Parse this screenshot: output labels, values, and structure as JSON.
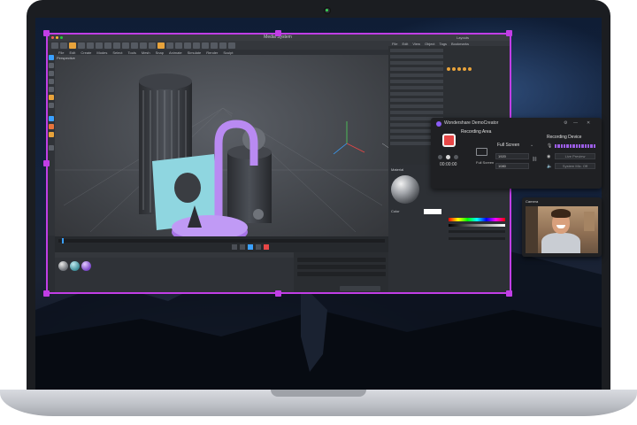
{
  "app": {
    "window_title": "Media System",
    "layout_label": "Layouts",
    "viewport_label": "Perspective",
    "menus": [
      "File",
      "Edit",
      "Create",
      "Modes",
      "Select",
      "Tools",
      "Mesh",
      "Snap",
      "Animate",
      "Simulate",
      "Render",
      "Sculpt",
      "Motion Tracker",
      "MoGraph",
      "Character",
      "Pipeline",
      "Plugins",
      "Script",
      "Window",
      "Help"
    ],
    "right_menus": [
      "File",
      "Edit",
      "View",
      "Object",
      "Tags",
      "Bookmarks"
    ],
    "attr_tab": "Material",
    "color_label": "Color"
  },
  "recorder": {
    "title": "Wondershare DemoCreator",
    "mode": "Recording Area",
    "timer": "00:00:00",
    "source": "Full Screen",
    "width": "1920",
    "height": "1080",
    "fullscreen_caption": "Full Screen",
    "device_title": "Recording Device",
    "device_btn1": "Live Preview",
    "device_btn2": "System Mic. Off",
    "level_bars": 14
  },
  "webcam": {
    "title": "Camera"
  },
  "colors": {
    "selection": "#c13ee6",
    "record": "#e84747",
    "purple_object": "#b98af2",
    "cyan_object": "#8fd6e0"
  }
}
